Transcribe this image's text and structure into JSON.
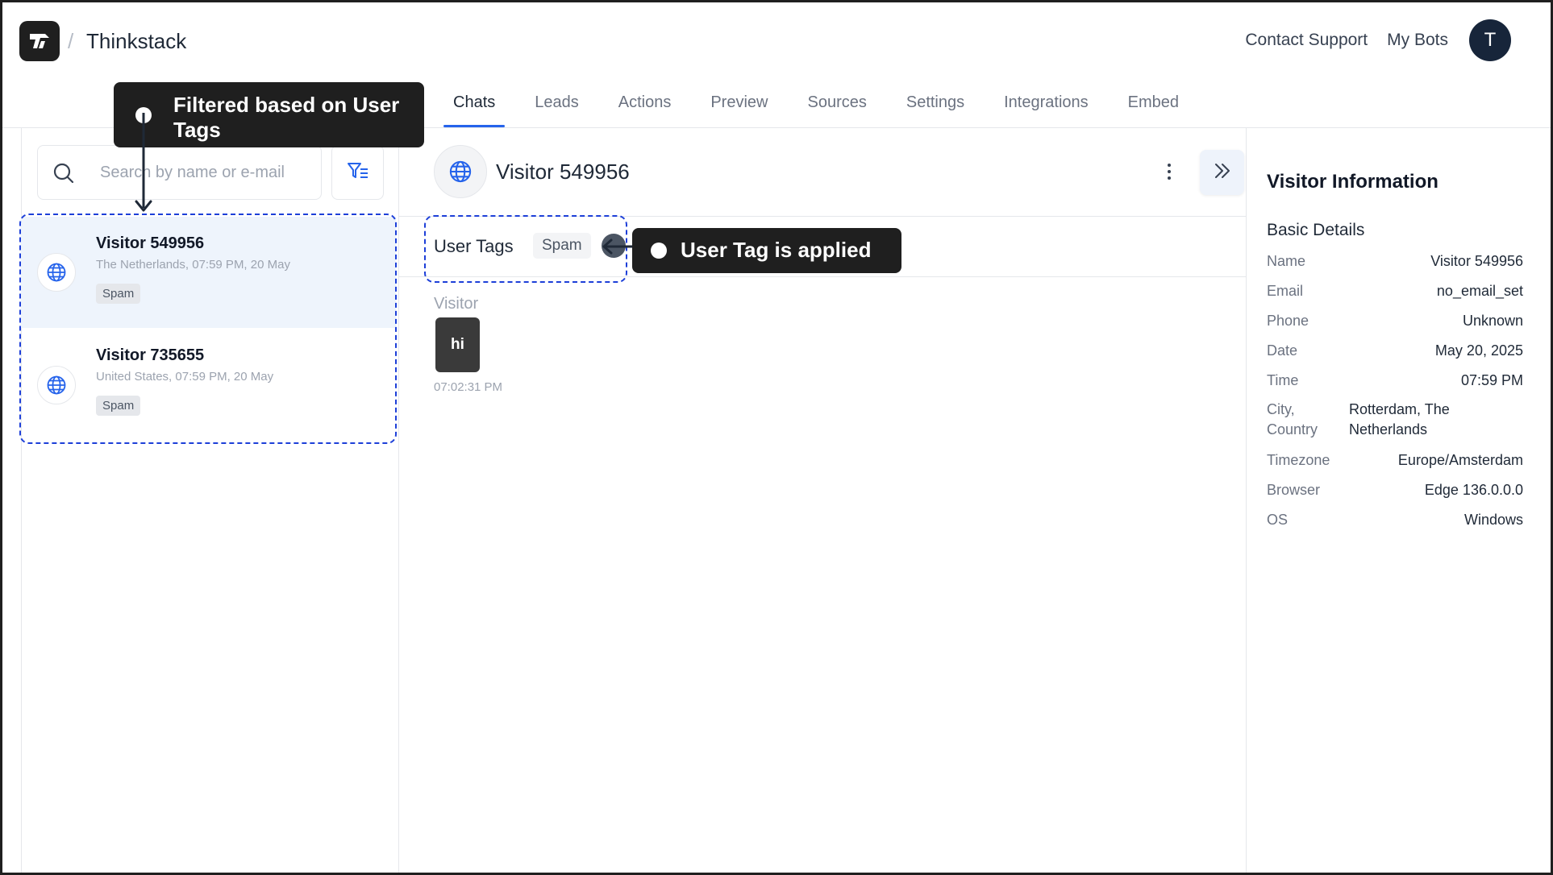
{
  "app": {
    "brand": "Thinkstack",
    "separator": "/"
  },
  "topnav": {
    "contact_support": "Contact Support",
    "my_bots": "My Bots",
    "avatar_initial": "T"
  },
  "tabs": [
    {
      "label": "Chats",
      "active": true
    },
    {
      "label": "Leads"
    },
    {
      "label": "Actions"
    },
    {
      "label": "Preview"
    },
    {
      "label": "Sources"
    },
    {
      "label": "Settings"
    },
    {
      "label": "Integrations"
    },
    {
      "label": "Embed"
    }
  ],
  "sidebar": {
    "search_placeholder": "Search by name or e-mail",
    "chats": [
      {
        "name": "Visitor 549956",
        "meta": "The Netherlands, 07:59 PM, 20 May",
        "tag": "Spam",
        "selected": true
      },
      {
        "name": "Visitor 735655",
        "meta": "United States, 07:59 PM, 20 May",
        "tag": "Spam"
      }
    ]
  },
  "chat": {
    "title": "Visitor 549956",
    "user_tags_label": "User Tags",
    "tag": "Spam",
    "messages": [
      {
        "from": "Visitor",
        "text": "hi",
        "time": "07:02:31 PM"
      }
    ]
  },
  "callouts": {
    "filter": "Filtered based on User Tags",
    "tag_applied": "User Tag is applied"
  },
  "visitor_info": {
    "title": "Visitor Information",
    "section": "Basic Details",
    "rows": [
      {
        "key": "Name",
        "value": "Visitor 549956"
      },
      {
        "key": "Email",
        "value": "no_email_set"
      },
      {
        "key": "Phone",
        "value": "Unknown"
      },
      {
        "key": "Date",
        "value": "May 20, 2025"
      },
      {
        "key": "Time",
        "value": "07:59 PM"
      },
      {
        "key": "City, Country",
        "value": "Rotterdam, The Netherlands"
      },
      {
        "key": "Timezone",
        "value": "Europe/Amsterdam"
      },
      {
        "key": "Browser",
        "value": "Edge 136.0.0.0"
      },
      {
        "key": "OS",
        "value": "Windows"
      }
    ]
  },
  "colors": {
    "accent": "#2563eb",
    "annotation": "#1d3fd8",
    "callout_bg": "#1f1f1f",
    "selected_row": "#eef4fc"
  },
  "icons": [
    "logo-icon",
    "search-icon",
    "filter-icon",
    "globe-icon",
    "more-vertical-icon",
    "chevrons-right-icon"
  ]
}
